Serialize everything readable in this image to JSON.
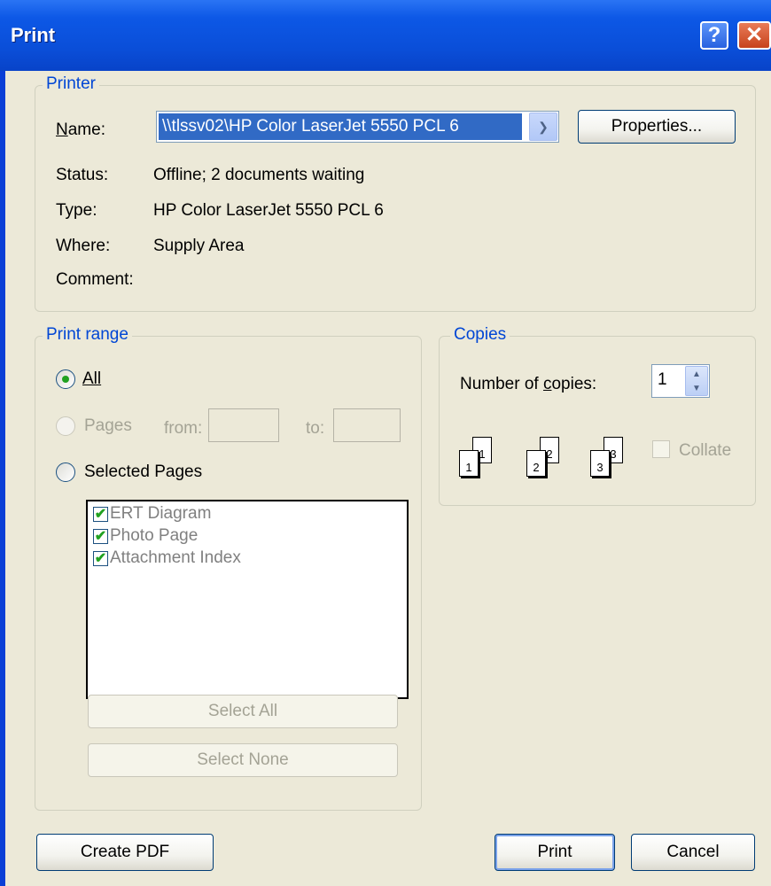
{
  "window": {
    "title": "Print",
    "help_icon": "?",
    "close_icon": "✕"
  },
  "printer": {
    "group_label": "Printer",
    "name_label": "Name:",
    "name_value": "\\\\tlssv02\\HP Color LaserJet 5550 PCL 6",
    "properties_button": "Properties...",
    "status_label": "Status:",
    "status_value": "Offline; 2 documents waiting",
    "type_label": "Type:",
    "type_value": "HP Color LaserJet 5550 PCL 6",
    "where_label": "Where:",
    "where_value": "Supply Area",
    "comment_label": "Comment:",
    "comment_value": ""
  },
  "print_range": {
    "group_label": "Print range",
    "all_label": "All",
    "pages_label": "Pages",
    "from_label": "from:",
    "to_label": "to:",
    "from_value": "",
    "to_value": "",
    "selected_pages_label": "Selected Pages",
    "selected_option": "All",
    "page_list": [
      {
        "label": "ERT Diagram",
        "checked": true
      },
      {
        "label": "Photo Page",
        "checked": true
      },
      {
        "label": "Attachment Index",
        "checked": true
      }
    ],
    "select_all_button": "Select All",
    "select_none_button": "Select None"
  },
  "copies": {
    "group_label": "Copies",
    "number_label": "Number of copies:",
    "number_value": "1",
    "collate_label": "Collate",
    "collate_checked": false,
    "page_numbers": [
      "1",
      "1",
      "2",
      "2",
      "3",
      "3"
    ]
  },
  "buttons": {
    "create_pdf": "Create PDF",
    "print": "Print",
    "cancel": "Cancel"
  }
}
